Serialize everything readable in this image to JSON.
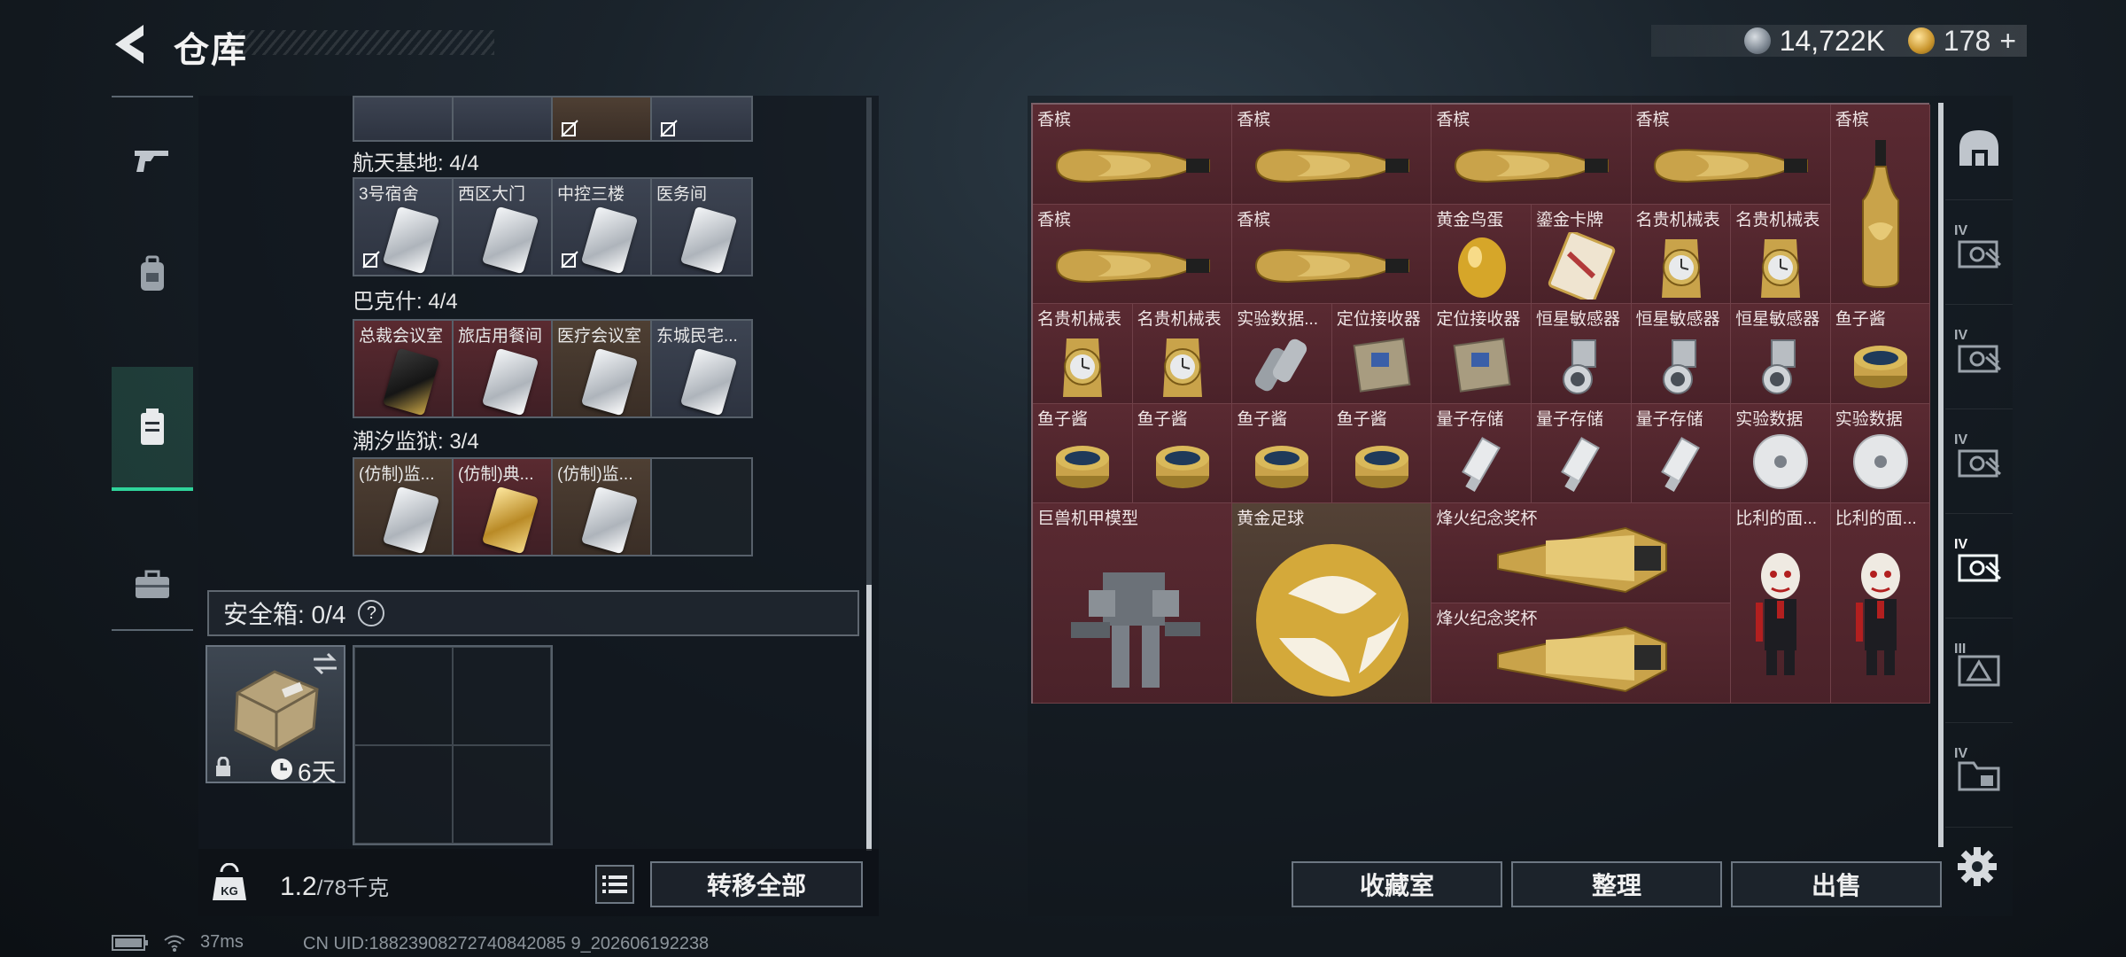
{
  "header": {
    "title": "仓库",
    "currency_silver": "14,722K",
    "currency_gold": "178",
    "currency_gold_plus": "+"
  },
  "left_nav": [
    "gun-icon",
    "backpack-icon",
    "container-icon",
    "briefcase-icon"
  ],
  "key_groups": {
    "top_partial": {
      "cells": [
        {
          "label": "",
          "bg": "blue"
        },
        {
          "label": "",
          "bg": "blue"
        },
        {
          "label": "",
          "bg": "brown"
        },
        {
          "label": "",
          "bg": "blue"
        }
      ]
    },
    "hangtian": {
      "title": "航天基地: 4/4",
      "cells": [
        {
          "label": "3号宿舍",
          "bg": "blue",
          "card": "silver"
        },
        {
          "label": "西区大门",
          "bg": "blue",
          "card": "silver"
        },
        {
          "label": "中控三楼",
          "bg": "blue",
          "card": "silver"
        },
        {
          "label": "医务间",
          "bg": "blue",
          "card": "silver"
        }
      ]
    },
    "bakeshi": {
      "title": "巴克什: 4/4",
      "cells": [
        {
          "label": "总裁会议室",
          "bg": "red",
          "card": "dark"
        },
        {
          "label": "旅店用餐间",
          "bg": "red",
          "card": "silver"
        },
        {
          "label": "医疗会议室",
          "bg": "brown",
          "card": "silver"
        },
        {
          "label": "东城民宅...",
          "bg": "blue",
          "card": "silver"
        }
      ]
    },
    "chaoxi": {
      "title": "潮汐监狱: 3/4",
      "cells": [
        {
          "label": "(仿制)监...",
          "bg": "brown",
          "card": "silver"
        },
        {
          "label": "(仿制)典...",
          "bg": "red",
          "card": "gold"
        },
        {
          "label": "(仿制)监...",
          "bg": "brown",
          "card": "silver"
        },
        {
          "label": "",
          "bg": "empty",
          "card": ""
        }
      ]
    }
  },
  "safe": {
    "title": "安全箱: 0/4",
    "help": "?",
    "timer": "6天"
  },
  "weight": {
    "current": "1.2",
    "max": "/78千克"
  },
  "buttons": {
    "transfer_all": "转移全部",
    "collection": "收藏室",
    "sort": "整理",
    "sell": "出售"
  },
  "status": {
    "ping": "37ms",
    "uid": "CN UID:18823908272740842085 9_202606192238"
  },
  "stash_items": [
    {
      "label": "香槟",
      "icon": "champagne-bottle",
      "bg": "red"
    },
    {
      "label": "香槟",
      "icon": "champagne-bottle",
      "bg": "red"
    },
    {
      "label": "香槟",
      "icon": "champagne-bottle",
      "bg": "red"
    },
    {
      "label": "香槟",
      "icon": "champagne-bottle",
      "bg": "red"
    },
    {
      "label": "香槟",
      "icon": "champagne-bottle-upright",
      "bg": "red"
    },
    {
      "label": "香槟",
      "icon": "champagne-bottle",
      "bg": "red"
    },
    {
      "label": "香槟",
      "icon": "champagne-bottle",
      "bg": "red"
    },
    {
      "label": "黄金鸟蛋",
      "icon": "golden-egg",
      "bg": "red"
    },
    {
      "label": "鎏金卡牌",
      "icon": "gilded-card",
      "bg": "red"
    },
    {
      "label": "名贵机械表",
      "icon": "luxury-watch",
      "bg": "red"
    },
    {
      "label": "名贵机械表",
      "icon": "luxury-watch",
      "bg": "red"
    },
    {
      "label": "名贵机械表",
      "icon": "luxury-watch",
      "bg": "red"
    },
    {
      "label": "名贵机械表",
      "icon": "luxury-watch",
      "bg": "red"
    },
    {
      "label": "实验数据...",
      "icon": "data-device",
      "bg": "red"
    },
    {
      "label": "定位接收器",
      "icon": "locator-receiver",
      "bg": "red"
    },
    {
      "label": "定位接收器",
      "icon": "locator-receiver",
      "bg": "red"
    },
    {
      "label": "恒星敏感器",
      "icon": "star-sensor",
      "bg": "red"
    },
    {
      "label": "恒星敏感器",
      "icon": "star-sensor",
      "bg": "red"
    },
    {
      "label": "恒星敏感器",
      "icon": "star-sensor",
      "bg": "red"
    },
    {
      "label": "鱼子酱",
      "icon": "caviar-tin",
      "bg": "red"
    },
    {
      "label": "鱼子酱",
      "icon": "caviar-tin",
      "bg": "red"
    },
    {
      "label": "鱼子酱",
      "icon": "caviar-tin",
      "bg": "red"
    },
    {
      "label": "鱼子酱",
      "icon": "caviar-tin",
      "bg": "red"
    },
    {
      "label": "鱼子酱",
      "icon": "caviar-tin",
      "bg": "red"
    },
    {
      "label": "量子存储",
      "icon": "usb-drive",
      "bg": "red"
    },
    {
      "label": "量子存储",
      "icon": "usb-drive",
      "bg": "red"
    },
    {
      "label": "量子存储",
      "icon": "usb-drive",
      "bg": "red"
    },
    {
      "label": "实验数据",
      "icon": "data-disc",
      "bg": "red"
    },
    {
      "label": "实验数据",
      "icon": "data-disc",
      "bg": "red"
    },
    {
      "label": "巨兽机甲模型",
      "icon": "mech-model",
      "bg": "red"
    },
    {
      "label": "黄金足球",
      "icon": "golden-football",
      "bg": "brown"
    },
    {
      "label": "烽火纪念奖杯",
      "icon": "trophy",
      "bg": "red"
    },
    {
      "label": "烽火纪念奖杯",
      "icon": "trophy",
      "bg": "red"
    },
    {
      "label": "比利的面...",
      "icon": "puppet-doll",
      "bg": "red"
    },
    {
      "label": "比利的面...",
      "icon": "puppet-doll",
      "bg": "red"
    }
  ],
  "right_tabs": [
    {
      "icon": "base-icon",
      "tier": ""
    },
    {
      "icon": "stash-tab-icon",
      "tier": "IV"
    },
    {
      "icon": "stash-tab-icon",
      "tier": "IV"
    },
    {
      "icon": "stash-tab-icon",
      "tier": "IV"
    },
    {
      "icon": "stash-tab-icon",
      "tier": "IV"
    },
    {
      "icon": "stash-tab-triangle-icon",
      "tier": "III"
    },
    {
      "icon": "stash-tab-folder-icon",
      "tier": "IV"
    }
  ],
  "colors": {
    "accent": "#2fd49b",
    "item_red": "#4a2229",
    "gold": "#c9952d"
  }
}
